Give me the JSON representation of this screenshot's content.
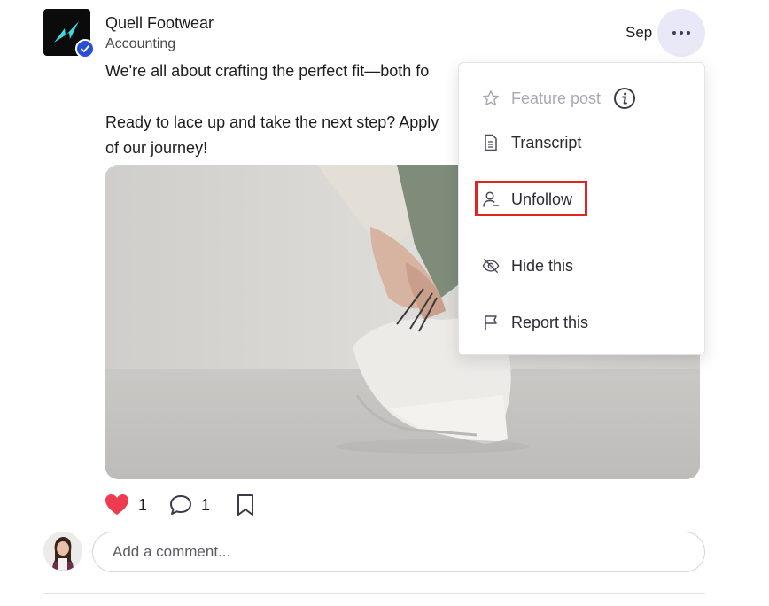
{
  "post": {
    "author": "Quell Footwear",
    "subtitle": "Accounting",
    "date": "Sep",
    "body_lines": [
      "We're all about crafting the perfect fit—both fo",
      "",
      "Ready to lace up and take the next step? Apply",
      "of our journey!"
    ],
    "image_alt": "Hands lacing a white sneaker",
    "likes": "1",
    "comments": "1"
  },
  "comment": {
    "placeholder": "Add a comment..."
  },
  "menu": {
    "items": [
      {
        "label": "Feature post",
        "icon": "star-icon",
        "disabled": true
      },
      {
        "label": "Transcript",
        "icon": "document-icon"
      },
      {
        "label": "Unfollow",
        "icon": "user-minus-icon"
      },
      {
        "label": "Hide this",
        "icon": "eye-slash-icon"
      },
      {
        "label": "Report this",
        "icon": "flag-icon"
      }
    ]
  },
  "colors": {
    "accent": "#2a4fd6",
    "highlight": "#e0261e",
    "heart": "#ef3b4f"
  }
}
